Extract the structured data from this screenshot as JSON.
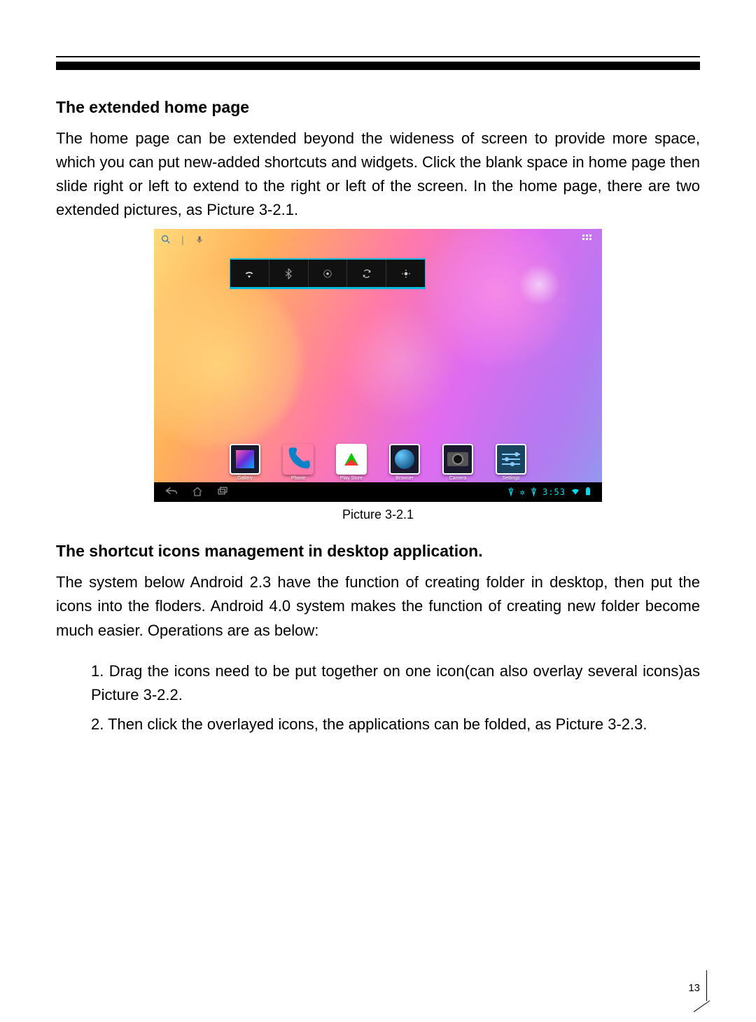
{
  "page_number": "13",
  "section1": {
    "heading": "The extended home page",
    "paragraph": "The home page can be extended beyond the wideness of screen to provide more space, which you can put new-added shortcuts and widgets. Click the blank space in home page then slide right or left to extend to the right or left of the screen. In the home page, there are two extended pictures, as Picture 3-2.1."
  },
  "figure": {
    "caption": "Picture 3-2.1",
    "statusbar_time": "3:53",
    "apps": [
      {
        "label": "Gallery"
      },
      {
        "label": "Phone"
      },
      {
        "label": "Play Store"
      },
      {
        "label": "Browser"
      },
      {
        "label": "Camera"
      },
      {
        "label": "Settings"
      }
    ]
  },
  "section2": {
    "heading": "The shortcut icons management in desktop application.",
    "paragraph": "The system below Android 2.3 have the function of creating folder in desktop, then put the icons into the floders. Android 4.0 system makes the function of creating new folder become much easier. Operations are as below:",
    "step1": "1. Drag the icons need to be put together on one icon(can also overlay several icons)as Picture 3-2.2.",
    "step2": "2. Then click the overlayed icons, the applications can be folded, as Picture 3-2.3."
  }
}
